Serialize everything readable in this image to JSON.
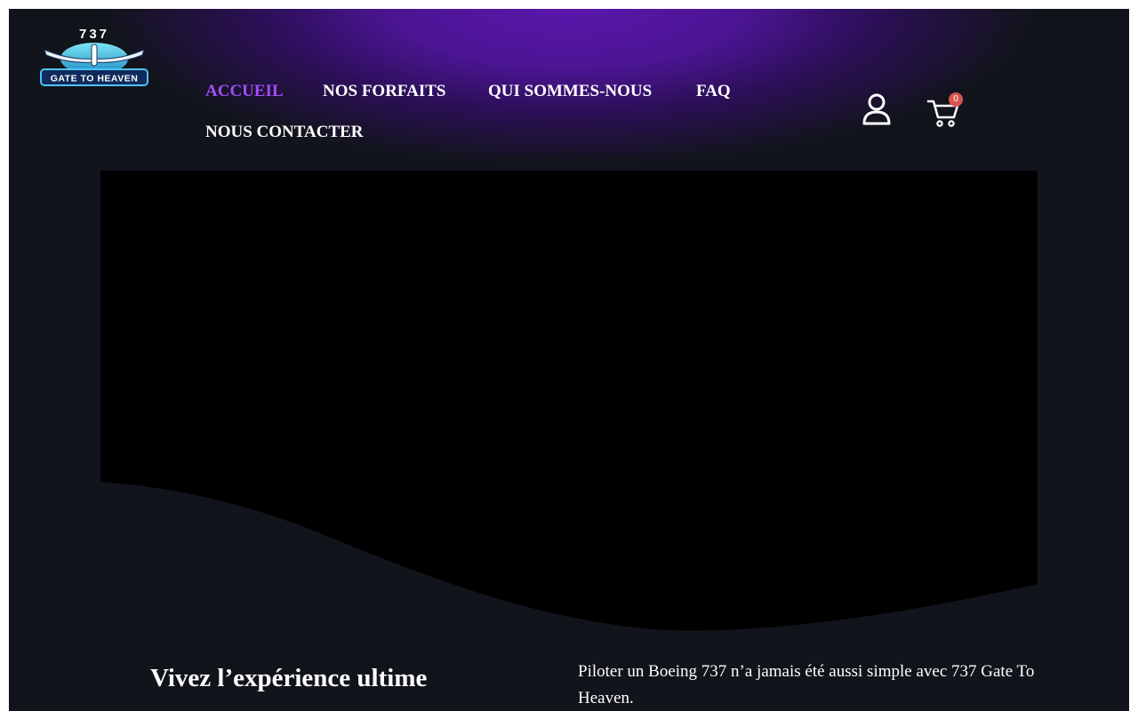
{
  "brand": {
    "logo_number": "737",
    "logo_text": "GATE TO HEAVEN"
  },
  "nav": {
    "items": [
      {
        "label": "ACCUEIL",
        "active": true
      },
      {
        "label": "NOS FORFAITS",
        "active": false
      },
      {
        "label": "QUI SOMMES-NOUS",
        "active": false
      },
      {
        "label": "FAQ",
        "active": false
      },
      {
        "label": "NOUS CONTACTER",
        "active": false
      }
    ]
  },
  "header_icons": {
    "account_icon": "user-icon",
    "cart_icon": "cart-icon",
    "cart_count": "0"
  },
  "hero": {
    "title": "Vivez l’expérience ultime",
    "description": "Piloter un Boeing 737 n’a jamais été aussi simple avec 737 Gate To Heaven."
  },
  "colors": {
    "accent": "#a34dfa",
    "header_glow": "#5a16ab",
    "background": "#12141c",
    "badge": "#d9534f"
  }
}
